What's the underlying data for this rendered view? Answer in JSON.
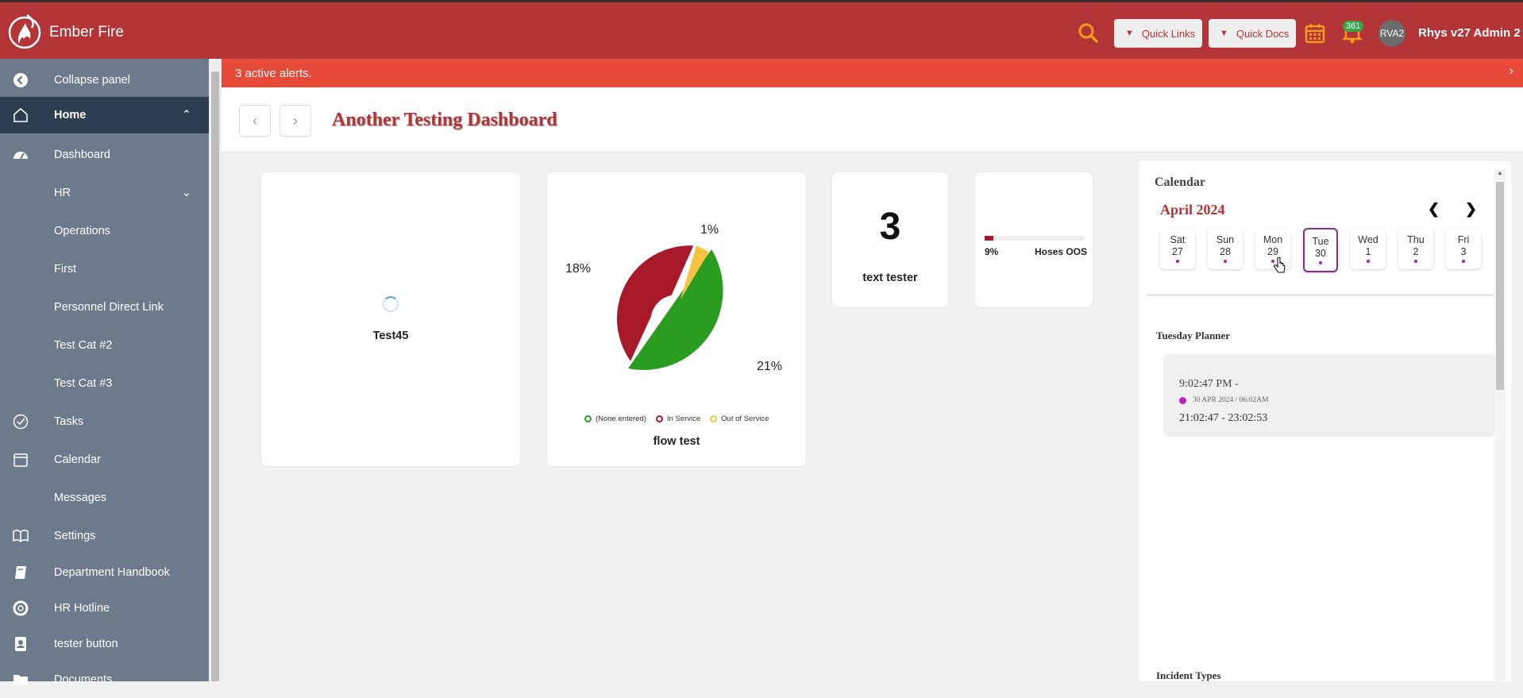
{
  "app": {
    "name": "Ember Fire"
  },
  "topbar": {
    "quick_links_label": "Quick Links",
    "quick_docs_label": "Quick Docs",
    "notification_count": "361",
    "avatar_text": "RVA2",
    "user_name": "Rhys v27 Admin 2",
    "accent": "#b33537",
    "search_icon_color": "#f59a1e"
  },
  "sidebar": {
    "collapse_label": "Collapse panel",
    "items": [
      {
        "label": "Home",
        "icon": "home-icon",
        "expanded": true
      },
      {
        "label": "Dashboard",
        "icon": "dashboard-icon"
      },
      {
        "label": "HR",
        "icon": "",
        "collapsed_chevron": true
      },
      {
        "label": "Operations",
        "icon": ""
      },
      {
        "label": "First",
        "icon": ""
      },
      {
        "label": "Personnel Direct Link",
        "icon": ""
      },
      {
        "label": "Test Cat #2",
        "icon": ""
      },
      {
        "label": "Test Cat #3",
        "icon": ""
      },
      {
        "label": "Tasks",
        "icon": "check-circle-icon"
      },
      {
        "label": "Calendar",
        "icon": "calendar-icon"
      },
      {
        "label": "Messages",
        "icon": ""
      },
      {
        "label": "Settings",
        "icon": "book-icon"
      },
      {
        "label": "Department Handbook",
        "icon": "handbook-icon"
      },
      {
        "label": "HR Hotline",
        "icon": "lifebuoy-icon"
      },
      {
        "label": "tester button",
        "icon": "contact-card-icon"
      },
      {
        "label": "Documents",
        "icon": "folder-icon"
      }
    ]
  },
  "alert": {
    "text": "3 active alerts.",
    "color": "#e84a3a"
  },
  "dashboard": {
    "title": "Another Testing Dashboard"
  },
  "widgets": {
    "test45": {
      "title": "Test45"
    },
    "flow": {
      "title": "flow test",
      "labels": {
        "red": "18%",
        "yellow": "1%",
        "green": "21%"
      },
      "legend": [
        "(None entered)",
        "In Service",
        "Out of Service"
      ],
      "legend_colors": [
        "#2a9c1f",
        "#a8192c",
        "#f5c242"
      ]
    },
    "text_tester": {
      "value": "3",
      "title": "text tester"
    },
    "hoses": {
      "percent": "9%",
      "fraction": 0.09,
      "label": "Hoses OOS"
    }
  },
  "calendar": {
    "title": "Calendar",
    "month": "April 2024",
    "days": [
      {
        "dow": "Sat",
        "num": "27"
      },
      {
        "dow": "Sun",
        "num": "28"
      },
      {
        "dow": "Mon",
        "num": "29"
      },
      {
        "dow": "Tue",
        "num": "30",
        "selected": true
      },
      {
        "dow": "Wed",
        "num": "1"
      },
      {
        "dow": "Thu",
        "num": "2"
      },
      {
        "dow": "Fri",
        "num": "3"
      }
    ],
    "planner_title": "Tuesday Planner",
    "event": {
      "time_line": "9:02:47 PM -",
      "date_line": "30 APR 2024  /  06:02AM",
      "range_line": "21:02:47 - 23:02:53"
    },
    "incident_title": "Incident Types"
  }
}
